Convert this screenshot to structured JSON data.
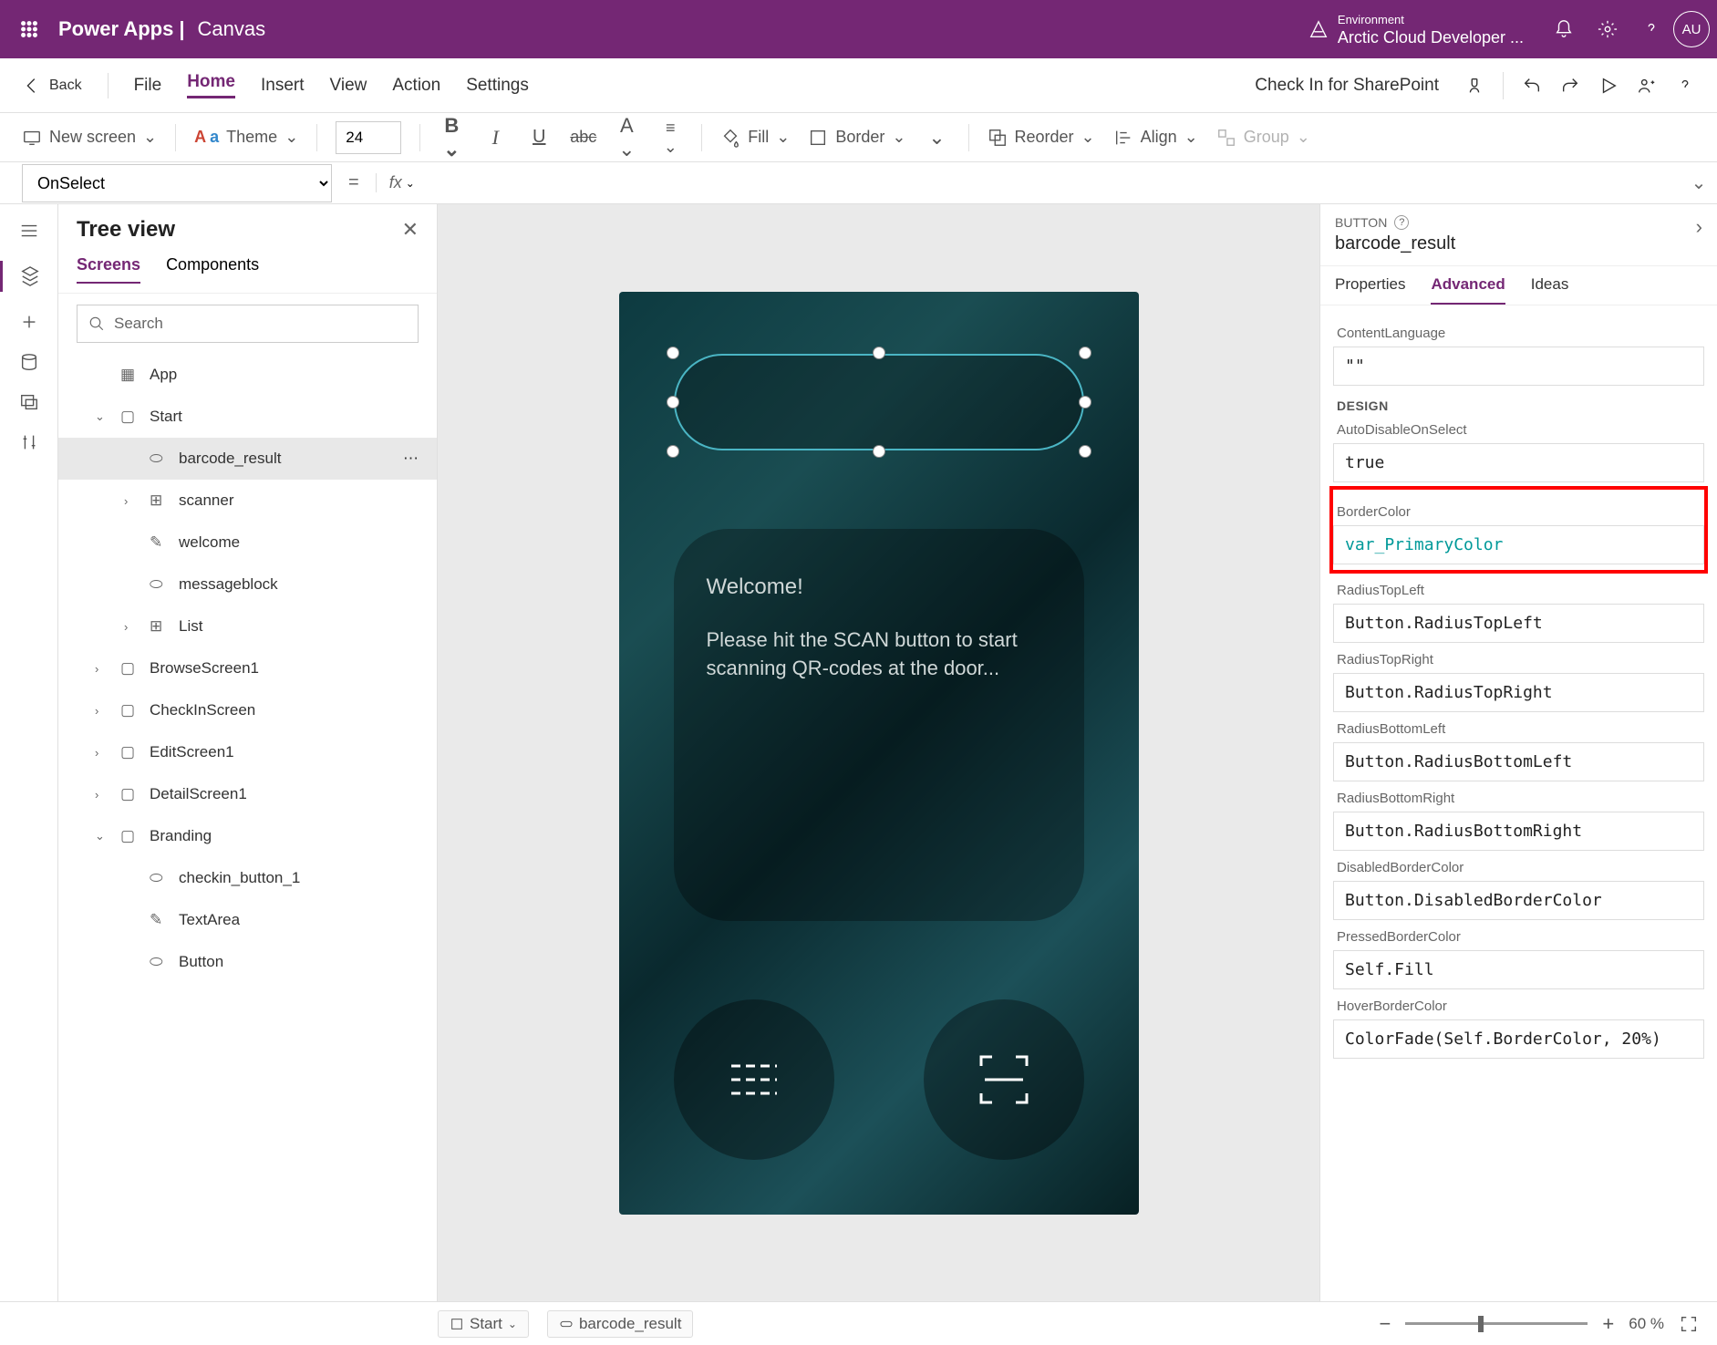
{
  "header": {
    "product": "Power Apps",
    "separator": "|",
    "subtitle": "Canvas",
    "env_label": "Environment",
    "env_name": "Arctic Cloud Developer ...",
    "avatar": "AU"
  },
  "menubar": {
    "back": "Back",
    "items": [
      "File",
      "Home",
      "Insert",
      "View",
      "Action",
      "Settings"
    ],
    "active": "Home",
    "check_in": "Check In for SharePoint"
  },
  "toolbar": {
    "new_screen": "New screen",
    "theme": "Theme",
    "font_size": "24",
    "fill": "Fill",
    "border": "Border",
    "reorder": "Reorder",
    "align": "Align",
    "group": "Group"
  },
  "formulabar": {
    "property": "OnSelect",
    "formula": ""
  },
  "tree": {
    "title": "Tree view",
    "tabs": [
      "Screens",
      "Components"
    ],
    "search_placeholder": "Search",
    "app": "App",
    "items": [
      {
        "label": "Start",
        "depth": 1,
        "expandable": true,
        "expanded": true,
        "icon": "screen"
      },
      {
        "label": "barcode_result",
        "depth": 2,
        "selected": true,
        "icon": "button"
      },
      {
        "label": "scanner",
        "depth": 2,
        "expandable": true,
        "icon": "group"
      },
      {
        "label": "welcome",
        "depth": 2,
        "icon": "text"
      },
      {
        "label": "messageblock",
        "depth": 2,
        "icon": "button"
      },
      {
        "label": "List",
        "depth": 2,
        "expandable": true,
        "icon": "group"
      },
      {
        "label": "BrowseScreen1",
        "depth": 1,
        "expandable": true,
        "icon": "screen"
      },
      {
        "label": "CheckInScreen",
        "depth": 1,
        "expandable": true,
        "icon": "screen"
      },
      {
        "label": "EditScreen1",
        "depth": 1,
        "expandable": true,
        "icon": "screen"
      },
      {
        "label": "DetailScreen1",
        "depth": 1,
        "expandable": true,
        "icon": "screen"
      },
      {
        "label": "Branding",
        "depth": 1,
        "expandable": true,
        "expanded": true,
        "icon": "screen"
      },
      {
        "label": "checkin_button_1",
        "depth": 2,
        "icon": "button"
      },
      {
        "label": "TextArea",
        "depth": 2,
        "icon": "text"
      },
      {
        "label": "Button",
        "depth": 2,
        "icon": "button"
      }
    ]
  },
  "canvas": {
    "welcome_title": "Welcome!",
    "welcome_body": "Please hit the SCAN button to start scanning QR-codes at the door..."
  },
  "props": {
    "type": "BUTTON",
    "name": "barcode_result",
    "tabs": [
      "Properties",
      "Advanced",
      "Ideas"
    ],
    "active_tab": "Advanced",
    "content_language_label": "ContentLanguage",
    "content_language_value": "\"\"",
    "design_section": "DESIGN",
    "fields": [
      {
        "label": "AutoDisableOnSelect",
        "value": "true"
      },
      {
        "label": "BorderColor",
        "value": "var_PrimaryColor",
        "highlight": true,
        "teal": true
      },
      {
        "label": "RadiusTopLeft",
        "value": "Button.RadiusTopLeft"
      },
      {
        "label": "RadiusTopRight",
        "value": "Button.RadiusTopRight"
      },
      {
        "label": "RadiusBottomLeft",
        "value": "Button.RadiusBottomLeft"
      },
      {
        "label": "RadiusBottomRight",
        "value": "Button.RadiusBottomRight"
      },
      {
        "label": "DisabledBorderColor",
        "value": "Button.DisabledBorderColor"
      },
      {
        "label": "PressedBorderColor",
        "value": "Self.Fill"
      },
      {
        "label": "HoverBorderColor",
        "value": "ColorFade(Self.BorderColor, 20%)"
      }
    ]
  },
  "bottombar": {
    "crumb1": "Start",
    "crumb2": "barcode_result",
    "zoom": "60 %"
  }
}
